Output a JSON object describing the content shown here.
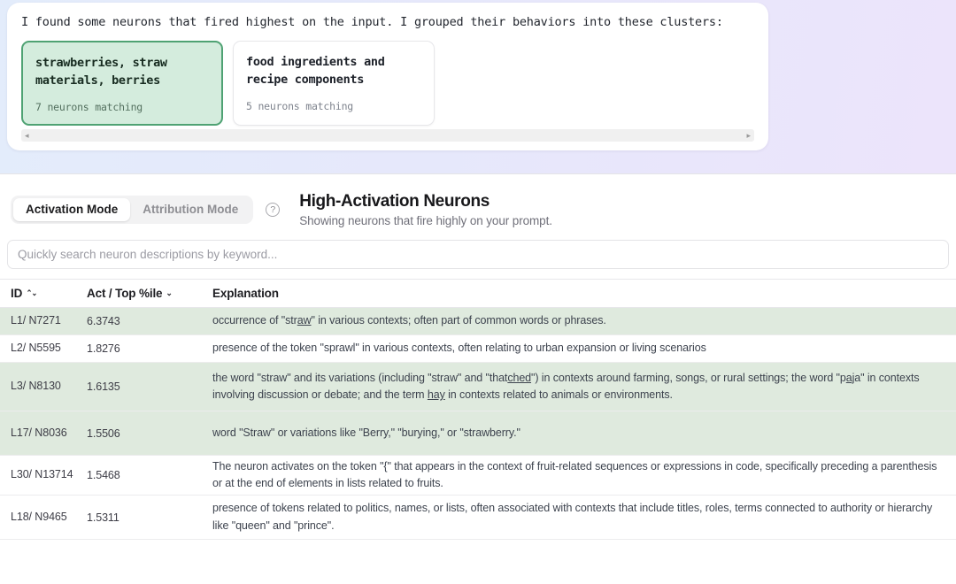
{
  "chat": {
    "intro": "I found some neurons that fired highest on the input. I grouped their behaviors into these clusters:",
    "clusters": [
      {
        "title": "strawberries, straw materials, berries",
        "count": "7 neurons matching",
        "selected": true
      },
      {
        "title": "food ingredients and recipe components",
        "count": "5 neurons matching",
        "selected": false
      }
    ],
    "scroll_left_arrow": "◂",
    "scroll_right_arrow": "▸"
  },
  "controls": {
    "mode_activation": "Activation Mode",
    "mode_attribution": "Attribution Mode",
    "active_mode": "Activation Mode",
    "help_glyph": "?",
    "heading_title": "High-Activation Neurons",
    "heading_subtitle": "Showing neurons that fire highly on your prompt."
  },
  "search": {
    "placeholder": "Quickly search neuron descriptions by keyword...",
    "value": ""
  },
  "table": {
    "columns": [
      {
        "label": "ID",
        "sort_icon": "⌃⌄",
        "sort_state": "sortable"
      },
      {
        "label": "Act / Top %ile",
        "sort_icon": "⌄",
        "sort_state": "sorted-desc"
      },
      {
        "label": "Explanation",
        "sort_icon": "",
        "sort_state": "none"
      }
    ],
    "rows": [
      {
        "id": "L1/ N7271",
        "act": "6.3743",
        "explanation_html": "occurrence of \"str<u>aw</u>\" in various contexts; often part of common words or phrases.",
        "highlighted": true
      },
      {
        "id": "L2/ N5595",
        "act": "1.8276",
        "explanation_html": "presence of the token \"sprawl\" in various contexts, often relating to urban expansion or living scenarios",
        "highlighted": false
      },
      {
        "id": "L3/ N8130",
        "act": "1.6135",
        "explanation_html": "the word \"straw\" and its variations (including \"straw\" and \"that<u>ched</u>\") in contexts around farming, songs, or rural settings; the word \"p<u>aj</u>a\" in contexts involving discussion or debate; and the term <u>hay</u> in contexts related to animals or environments.",
        "highlighted": true
      },
      {
        "id": "L17/ N8036",
        "act": "1.5506",
        "explanation_html": "word \"Straw\" or variations like \"Berry,\" \"burying,\" or \"strawberry.\"",
        "highlighted": true
      },
      {
        "id": "L30/ N13714",
        "act": "1.5468",
        "explanation_html": "The neuron activates on the token \"{\" that appears in the context of fruit-related sequences or expressions in code, specifically preceding a parenthesis or at the end of elements in lists related to fruits.",
        "highlighted": false
      },
      {
        "id": "L18/ N9465",
        "act": "1.5311",
        "explanation_html": "presence of tokens related to politics, names, or lists, often associated with contexts that include titles, roles, terms connected to authority or hierarchy like \"queen\" and \"prince\".",
        "highlighted": false
      }
    ]
  },
  "colors": {
    "highlight_row": "#dfeade",
    "selected_cluster_bg": "#d4ecdd",
    "selected_cluster_border": "#4fa273",
    "gradient_left": "#e3ecfb",
    "gradient_right": "#ece4fb"
  }
}
